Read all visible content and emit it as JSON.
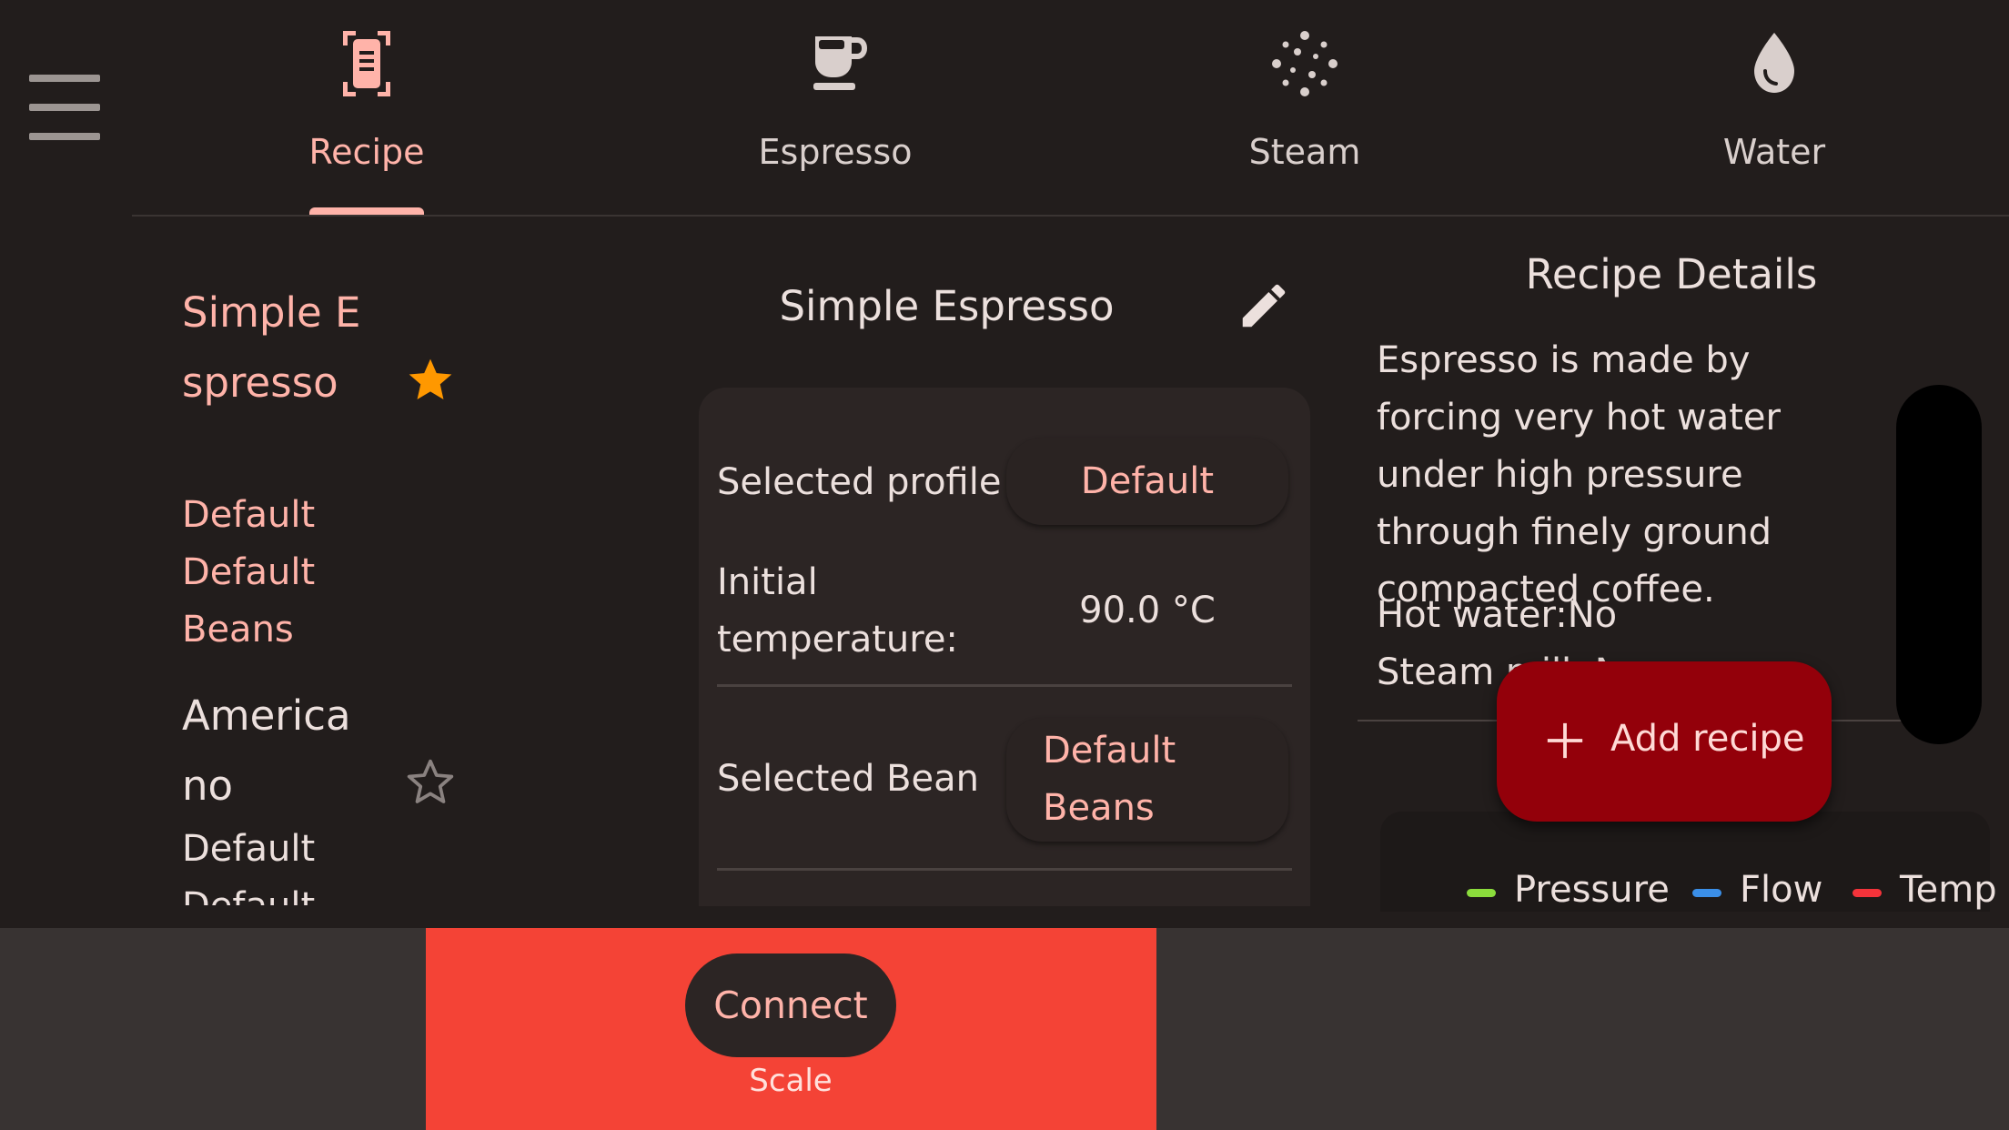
{
  "colors": {
    "accent": "#ffb3a9",
    "background": "#221d1c",
    "card": "#2c2524",
    "fab": "#93000a",
    "scale_bar": "#f44336",
    "bottom_bar": "#383332",
    "star_filled": "#ff9800"
  },
  "nav": {
    "menu_icon": "hamburger-menu-icon",
    "tabs": [
      {
        "label": "Recipe",
        "icon": "recipe-icon",
        "active": true
      },
      {
        "label": "Espresso",
        "icon": "coffee-cup-icon",
        "active": false
      },
      {
        "label": "Steam",
        "icon": "steam-icon",
        "active": false
      },
      {
        "label": "Water",
        "icon": "water-drop-icon",
        "active": false
      }
    ]
  },
  "recipes": [
    {
      "name": "Simple Espresso",
      "profile": "Default",
      "bean": "Default Beans",
      "favorite": true,
      "selected": true
    },
    {
      "name": "Americano",
      "profile": "Default",
      "bean": "Default",
      "favorite": false,
      "selected": false
    }
  ],
  "recipe_card": {
    "title": "Simple Espresso",
    "edit_icon": "pencil-icon",
    "selected_profile_label": "Selected profile",
    "selected_profile_value": "Default",
    "initial_temperature_label": "Initial temperature:",
    "initial_temperature_value": "90.0 °C",
    "selected_bean_label": "Selected Bean",
    "selected_bean_value": "Default Beans"
  },
  "details": {
    "title": "Recipe Details",
    "description": "Espresso is made by forcing very hot water under high pressure through finely ground compacted coffee.",
    "hot_water": "Hot water:No",
    "steam_milk": "Steam milk:No",
    "legend": [
      {
        "label": "Pressure",
        "color": "#8bdc3c"
      },
      {
        "label": "Flow",
        "color": "#3b8fe8"
      },
      {
        "label": "Temp",
        "color": "#f4333a"
      }
    ]
  },
  "fab": {
    "label": "Add recipe",
    "icon": "plus-icon"
  },
  "scale": {
    "button_label": "Connect",
    "label": "Scale"
  }
}
